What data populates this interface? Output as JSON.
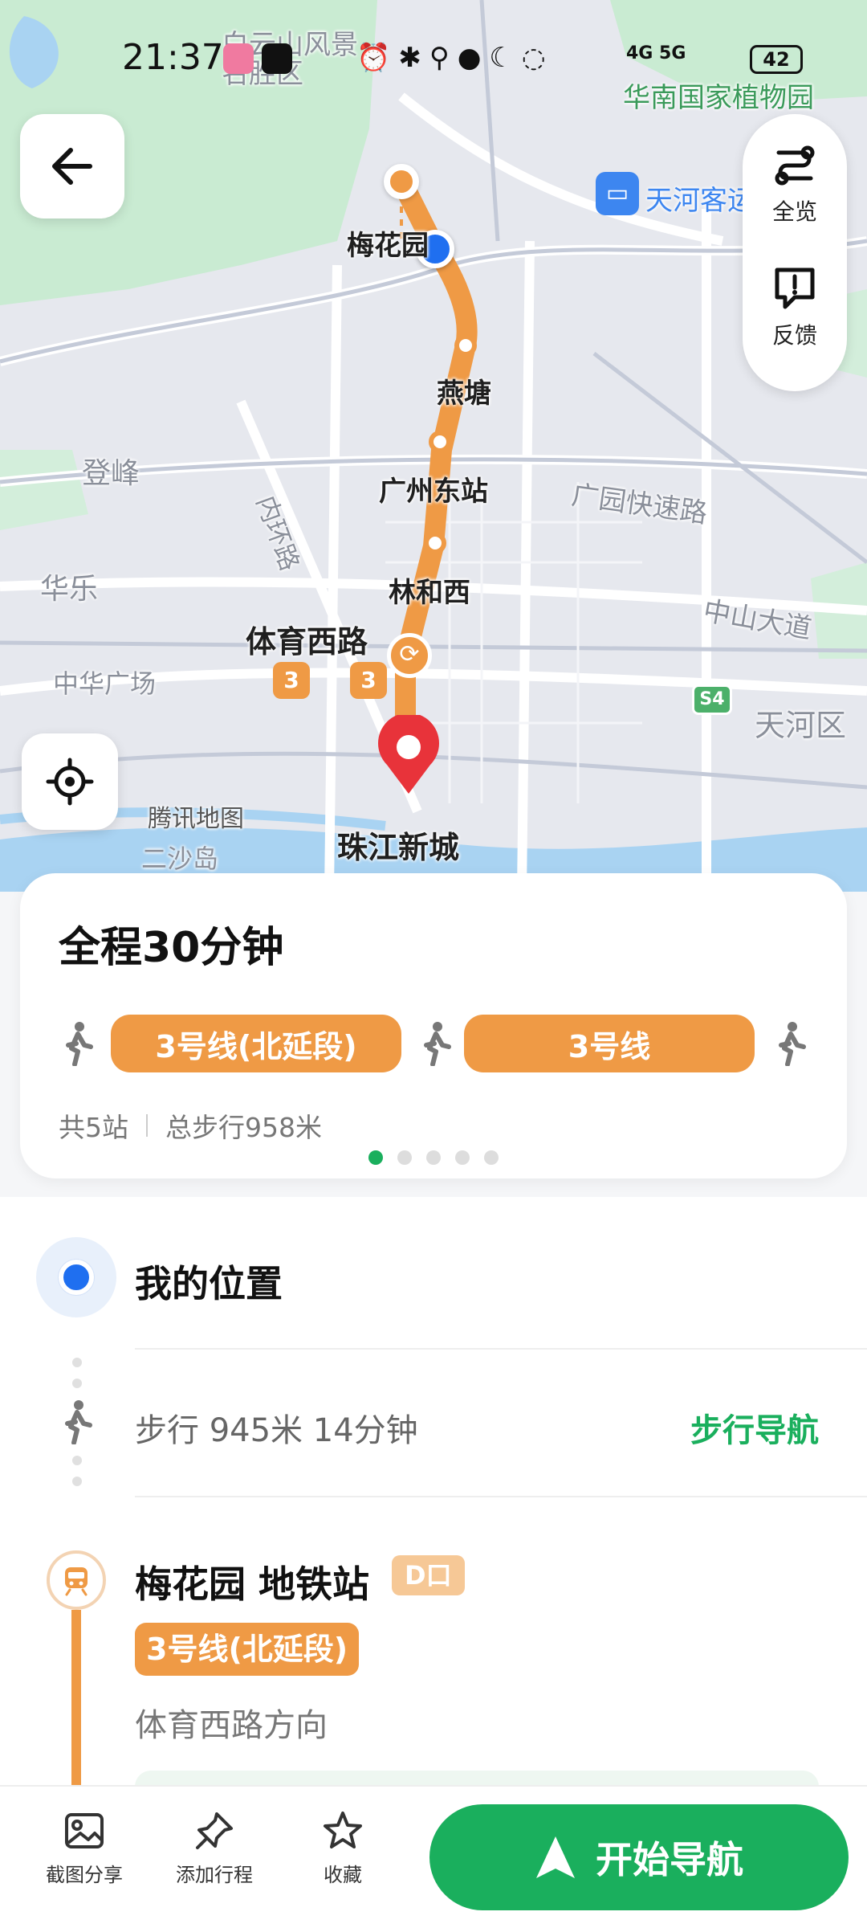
{
  "status_bar": {
    "time": "21:37",
    "network": "4G 5G",
    "battery": "42"
  },
  "map": {
    "labels": {
      "baiyunshan": "白云山风景",
      "baiyunshan2": "名胜区",
      "botanical": "华南国家植物园",
      "bus_station": "天河客运",
      "meihua": "梅花园",
      "yantang": "燕塘",
      "gzeast": "广州东站",
      "linhexi": "林和西",
      "tiyuxilu": "体育西路",
      "zhujiang": "珠江新城",
      "dengfeng": "登峰",
      "huale": "华乐",
      "huanlu": "内环路",
      "zhonghua": "中华广场",
      "guangyuan": "广园快速路",
      "zhongshan": "中山大道",
      "tianhe": "天河区",
      "tencent": "腾讯地图",
      "ershadao": "二沙岛",
      "s4": "S4",
      "line3_a": "3",
      "line3_b": "3"
    }
  },
  "buttons": {
    "overview": "全览",
    "feedback": "反馈"
  },
  "summary": {
    "title": "全程30分钟",
    "segments": [
      "3号线(北延段)",
      "3号线"
    ],
    "stations": "共5站",
    "walk_total": "总步行958米",
    "page_count": 5,
    "active_page": 1
  },
  "steps": {
    "origin": "我的位置",
    "walk": "步行 945米 14分钟",
    "walk_nav": "步行导航",
    "station": "梅花园 地铁站",
    "exit": "D口",
    "line": "3号线(北延段)",
    "direction": "体育西路方向"
  },
  "bottom_bar": {
    "screenshot_share": "截图分享",
    "add_trip": "添加行程",
    "favorite": "收藏",
    "start_nav": "开始导航"
  },
  "colors": {
    "accent_green": "#1aaf5d",
    "line3_orange": "#ef9a45",
    "origin_blue": "#1f6ff0",
    "destination_red": "#e8333a"
  }
}
